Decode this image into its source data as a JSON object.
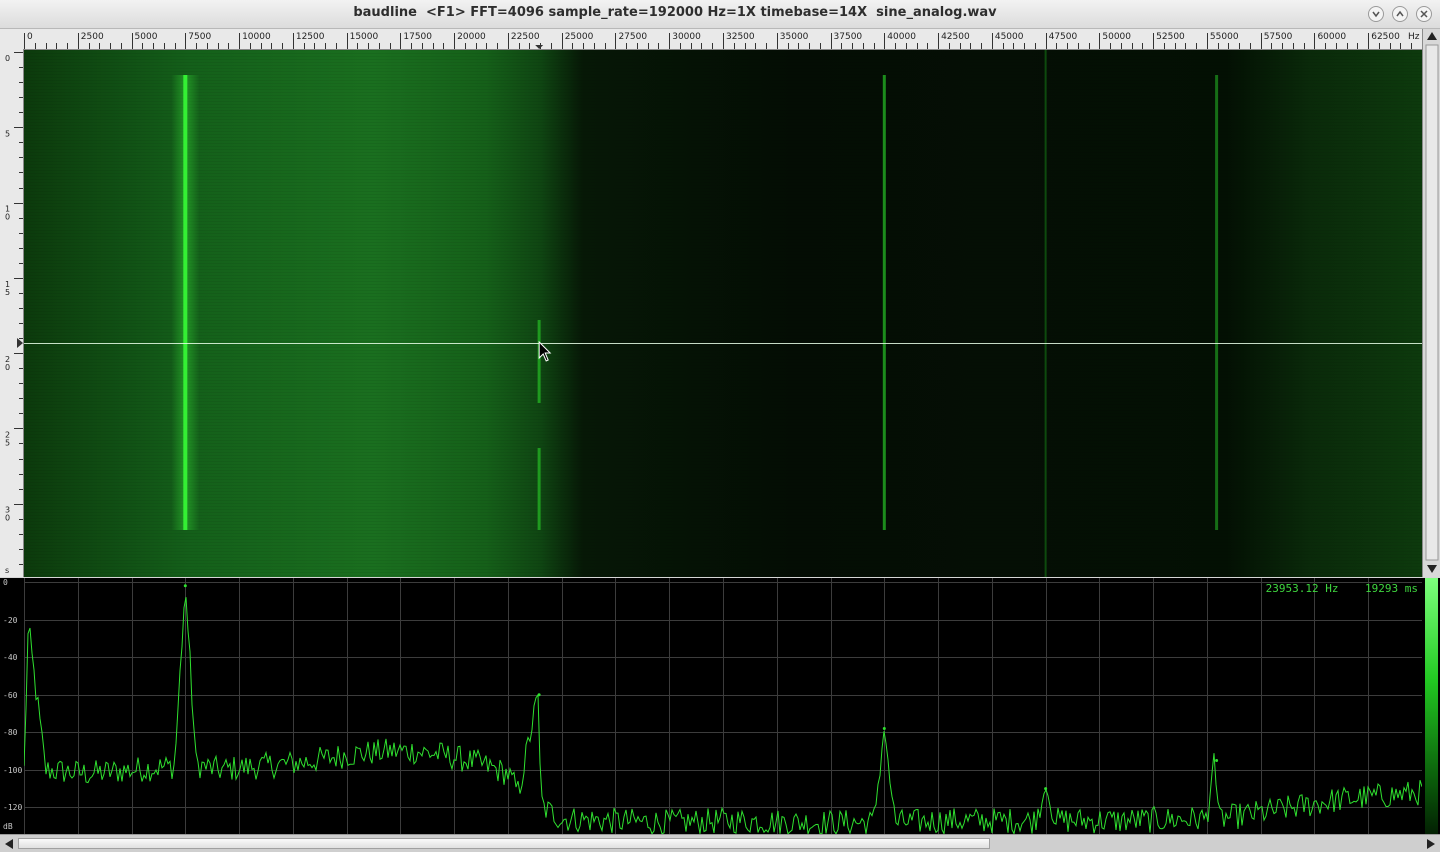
{
  "window": {
    "title": "baudline  <F1> FFT=4096 sample_rate=192000 Hz=1X timebase=14X  sine_analog.wav",
    "buttons": [
      "minimize-icon",
      "maximize-icon",
      "close-icon"
    ]
  },
  "frequency_axis": {
    "unit": "Hz",
    "labels": [
      "0",
      "2500",
      "5000",
      "7500",
      "10000",
      "12500",
      "15000",
      "17500",
      "20000",
      "22500",
      "25000",
      "27500",
      "30000",
      "32500",
      "35000",
      "37500",
      "40000",
      "42500",
      "45000",
      "47500",
      "50000",
      "52500",
      "55000",
      "57500",
      "60000",
      "62500"
    ]
  },
  "time_axis": {
    "unit": "s",
    "labels": [
      "0",
      "5",
      "10",
      "15",
      "20",
      "25",
      "30"
    ]
  },
  "db_axis": {
    "unit": "dB",
    "labels": [
      "0",
      "-20",
      "-40",
      "-60",
      "-80",
      "-100",
      "-120"
    ]
  },
  "readout": {
    "frequency": "23953.12 Hz",
    "time": "19293 ms"
  },
  "colors": {
    "trace": "#2fe02f",
    "grid": "#3c3c3c",
    "cursor": "#e8ffe8"
  },
  "chart_data": {
    "type": "line",
    "title": "",
    "xlabel": "Hz",
    "ylabel": "dB",
    "xlim": [
      0,
      65000
    ],
    "ylim": [
      -132,
      0
    ],
    "series": [
      {
        "x": [
          0,
          200,
          1000,
          3000,
          5000,
          7000,
          7500,
          8000,
          9000,
          11000,
          13000,
          15000,
          17000,
          18000,
          19500,
          21000,
          22500,
          23000,
          23900,
          24000,
          24100,
          25000,
          27000,
          30000,
          33000,
          36000,
          39500,
          40000,
          40500,
          43000,
          47000,
          47500,
          48000,
          51000,
          55000,
          55300,
          55600,
          58000,
          61000,
          65000
        ],
        "y": [
          -100,
          -24,
          -100,
          -102,
          -100,
          -98,
          -2,
          -97,
          -100,
          -98,
          -96,
          -92,
          -90,
          -90,
          -92,
          -96,
          -102,
          -112,
          -60,
          -100,
          -120,
          -126,
          -127,
          -128,
          -127,
          -128,
          -128,
          -78,
          -128,
          -127,
          -127,
          -110,
          -127,
          -127,
          -126,
          -95,
          -126,
          -122,
          -116,
          -112
        ]
      }
    ],
    "peaks": [
      {
        "x": 7500,
        "y": -2
      },
      {
        "x": 23950,
        "y": -60
      },
      {
        "x": 40000,
        "y": -78
      },
      {
        "x": 47500,
        "y": -110
      },
      {
        "x": 55450,
        "y": -95
      }
    ]
  }
}
